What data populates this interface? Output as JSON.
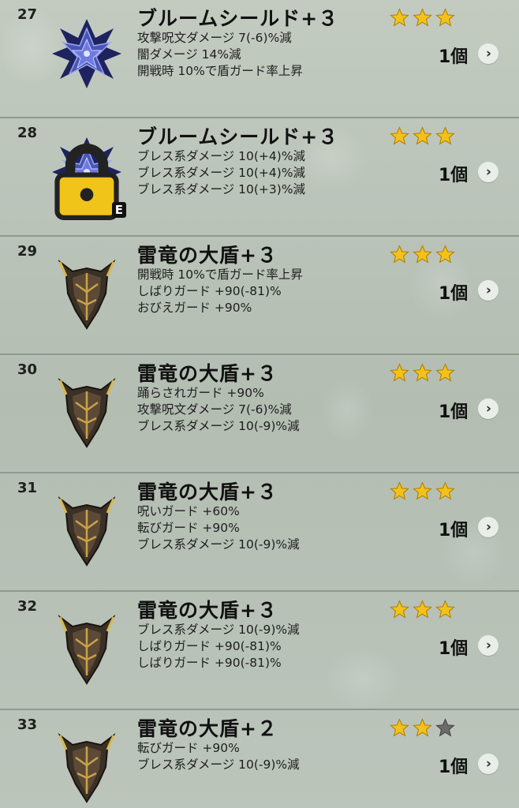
{
  "items": [
    {
      "number": "27",
      "name": "ブルームシールド+３",
      "icon": "bloom-shield-icon",
      "locked": false,
      "equipped": false,
      "effects": [
        "攻撃呪文ダメージ 7(-6)%減",
        "闇ダメージ 14%減",
        "開戦時 10%で盾ガード率上昇"
      ],
      "stars": 3,
      "quantity": "1個"
    },
    {
      "number": "28",
      "name": "ブルームシールド+３",
      "icon": "bloom-shield-icon",
      "locked": true,
      "equipped": true,
      "equip_badge": "E",
      "effects": [
        "ブレス系ダメージ 10(+4)%減",
        "ブレス系ダメージ 10(+4)%減",
        "ブレス系ダメージ 10(+3)%減"
      ],
      "stars": 3,
      "quantity": "1個"
    },
    {
      "number": "29",
      "name": "雷竜の大盾+３",
      "icon": "thunder-dragon-shield-icon",
      "locked": false,
      "equipped": false,
      "effects": [
        "開戦時 10%で盾ガード率上昇",
        "しばりガード +90(-81)%",
        "おびえガード +90%"
      ],
      "stars": 3,
      "quantity": "1個"
    },
    {
      "number": "30",
      "name": "雷竜の大盾+３",
      "icon": "thunder-dragon-shield-icon",
      "locked": false,
      "equipped": false,
      "effects": [
        "踊らされガード +90%",
        "攻撃呪文ダメージ 7(-6)%減",
        "ブレス系ダメージ 10(-9)%減"
      ],
      "stars": 3,
      "quantity": "1個"
    },
    {
      "number": "31",
      "name": "雷竜の大盾+３",
      "icon": "thunder-dragon-shield-icon",
      "locked": false,
      "equipped": false,
      "effects": [
        "呪いガード +60%",
        "転びガード +90%",
        "ブレス系ダメージ 10(-9)%減"
      ],
      "stars": 3,
      "quantity": "1個"
    },
    {
      "number": "32",
      "name": "雷竜の大盾+３",
      "icon": "thunder-dragon-shield-icon",
      "locked": false,
      "equipped": false,
      "effects": [
        "ブレス系ダメージ 10(-9)%減",
        "しばりガード +90(-81)%",
        "しばりガード +90(-81)%"
      ],
      "stars": 3,
      "quantity": "1個"
    },
    {
      "number": "33",
      "name": "雷竜の大盾+２",
      "icon": "thunder-dragon-shield-icon",
      "locked": false,
      "equipped": false,
      "effects": [
        "転びガード +90%",
        "ブレス系ダメージ 10(-9)%減"
      ],
      "stars": 2,
      "quantity": "1個"
    }
  ],
  "max_stars": 3,
  "colors": {
    "star_filled": "#f2c21a",
    "star_empty": "#6b6b6b",
    "background": "#b9c2b9",
    "divider": "#8f9a8f"
  }
}
